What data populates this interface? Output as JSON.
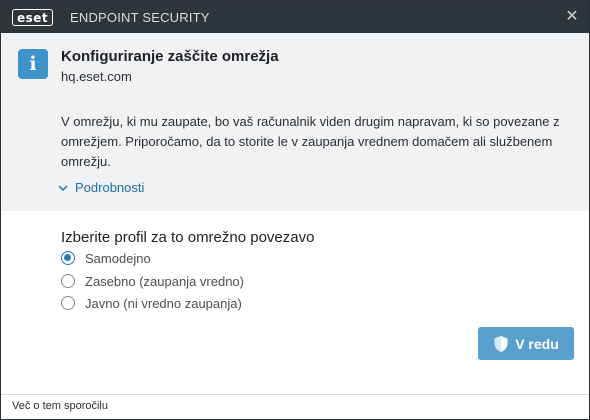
{
  "window": {
    "logo_text": "eset",
    "title": "ENDPOINT SECURITY",
    "close_glyph": "✕"
  },
  "header": {
    "icon": "info-icon",
    "title": "Konfiguriranje zaščite omrežja",
    "host": "hq.eset.com",
    "description": "V omrežju, ki mu zaupate, bo vaš računalnik viden drugim napravam, ki so povezane z omrežjem. Priporočamo, da to storite le v zaupanja vrednem domačem ali službenem omrežju.",
    "details_label": "Podrobnosti"
  },
  "profile": {
    "label": "Izberite profil za to omrežno povezavo",
    "options": [
      {
        "label": "Samodejno",
        "checked": true
      },
      {
        "label": "Zasebno (zaupanja vredno)",
        "checked": false
      },
      {
        "label": "Javno (ni vredno zaupanja)",
        "checked": false
      }
    ]
  },
  "actions": {
    "ok_label": "V redu"
  },
  "footer": {
    "link": "Več o tem sporočilu"
  },
  "colors": {
    "titlebar": "#2e353b",
    "header_bg": "#f0f2f3",
    "accent": "#3e93c9",
    "link": "#1f6fa8",
    "button": "#5aa0cf"
  }
}
